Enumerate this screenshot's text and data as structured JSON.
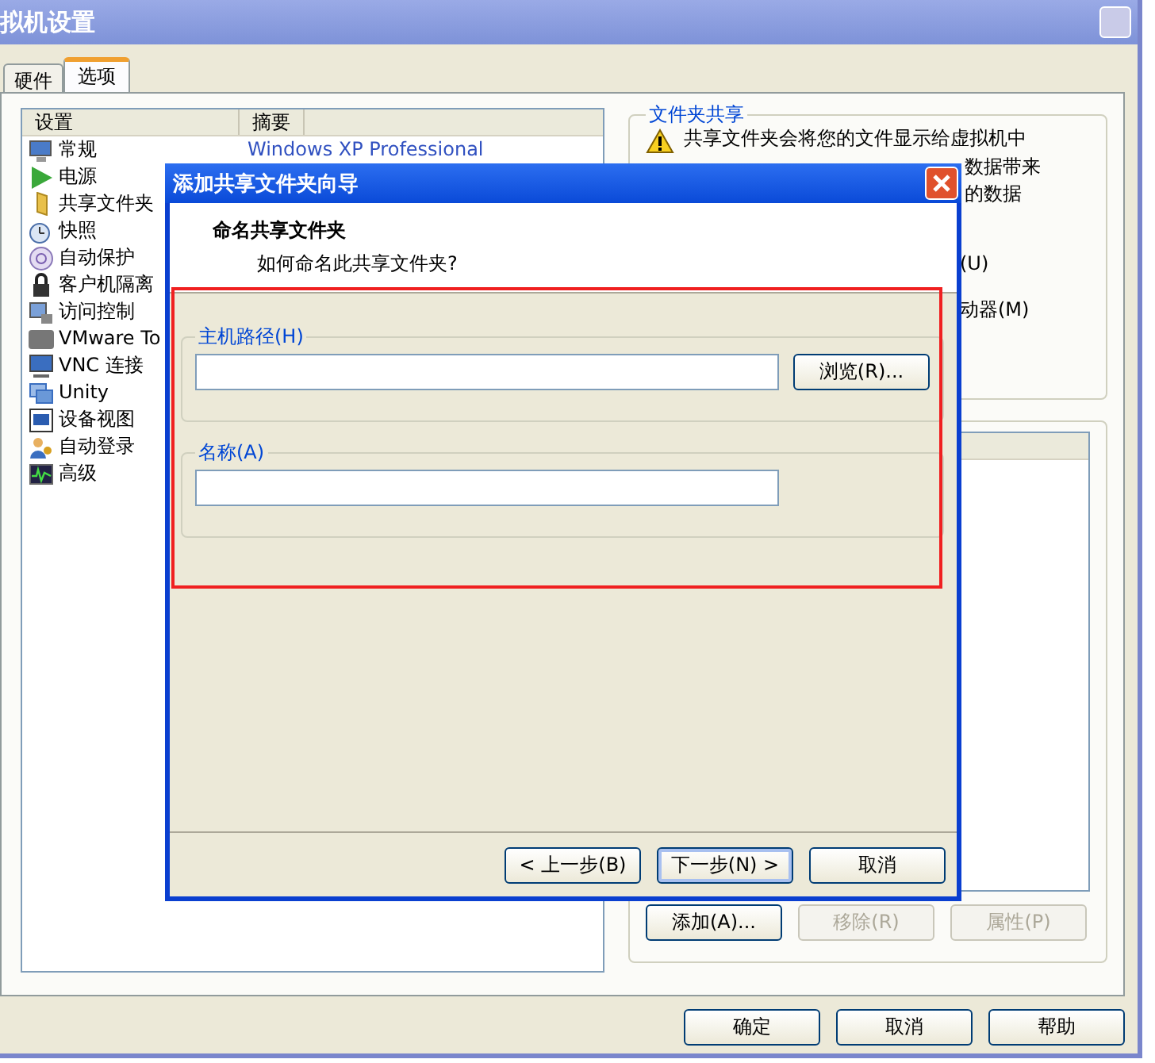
{
  "window": {
    "title": "拟机设置"
  },
  "tabs": [
    {
      "label": "硬件",
      "selected": false
    },
    {
      "label": "选项",
      "selected": true
    }
  ],
  "settings_list": {
    "columns": [
      "设置",
      "摘要"
    ],
    "rows": [
      {
        "name": "常规",
        "summary": "Windows XP Professional"
      },
      {
        "name": "电源"
      },
      {
        "name": "共享文件夹"
      },
      {
        "name": "快照"
      },
      {
        "name": "自动保护"
      },
      {
        "name": "客户机隔离"
      },
      {
        "name": "访问控制"
      },
      {
        "name": "VMware To"
      },
      {
        "name": "VNC 连接"
      },
      {
        "name": "Unity"
      },
      {
        "name": "设备视图"
      },
      {
        "name": "自动登录"
      },
      {
        "name": "高级"
      }
    ]
  },
  "folder_sharing": {
    "title": "文件夹共享",
    "warning_lines": [
      "共享文件夹会将您的文件显示给虚拟机中",
      "数据带来",
      "的数据"
    ],
    "options": [
      "(U)",
      "动器(M)"
    ]
  },
  "folder_list": {
    "buttons": [
      {
        "label": "添加(A)...",
        "disabled": false
      },
      {
        "label": "移除(R)",
        "disabled": true
      },
      {
        "label": "属性(P)",
        "disabled": true
      }
    ]
  },
  "footer_buttons": [
    "确定",
    "取消",
    "帮助"
  ],
  "dialog": {
    "title": "添加共享文件夹向导",
    "heading": "命名共享文件夹",
    "subheading": "如何命名此共享文件夹?",
    "groups": [
      {
        "label": "主机路径(H)",
        "button": "浏览(R)..."
      },
      {
        "label": "名称(A)"
      }
    ],
    "buttons": [
      {
        "label": "< 上一步(B)",
        "default": false
      },
      {
        "label": "下一步(N) >",
        "default": true
      },
      {
        "label": "取消",
        "default": false
      }
    ]
  }
}
